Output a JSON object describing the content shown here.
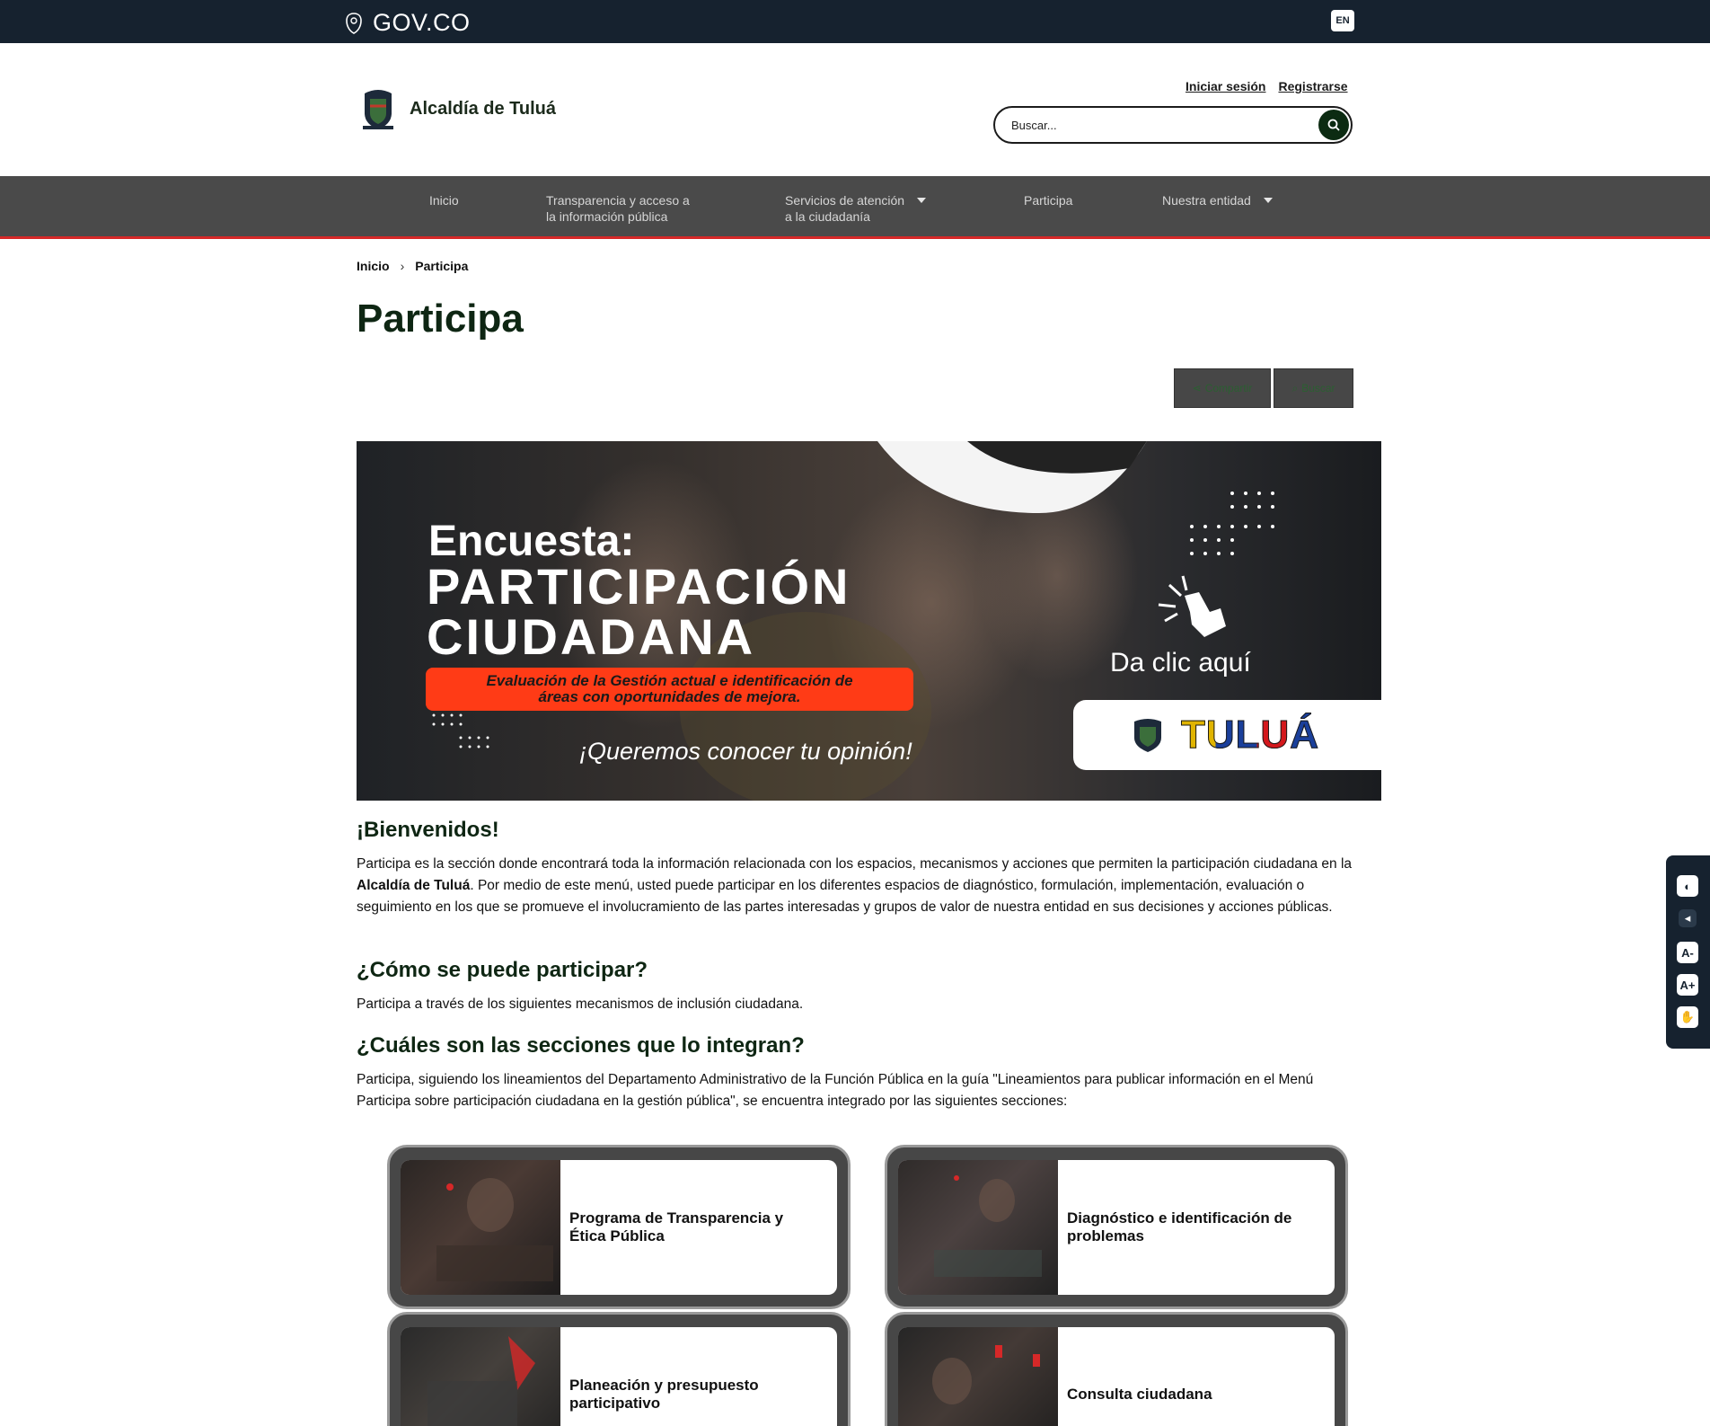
{
  "govbar": {
    "logo_text": "GOV.CO",
    "lang_button": "EN"
  },
  "header": {
    "brand_name": "Alcaldía de Tuluá",
    "login": "Iniciar sesión",
    "register": "Registrarse",
    "search_placeholder": "Buscar..."
  },
  "nav": {
    "items": [
      {
        "line1": "Inicio",
        "line2": ""
      },
      {
        "line1": "Transparencia y acceso a",
        "line2": "la información pública"
      },
      {
        "line1": "Servicios de atención",
        "line2": "a la ciudadanía"
      },
      {
        "line1": "Participa",
        "line2": ""
      },
      {
        "line1": "Nuestra entidad",
        "line2": ""
      }
    ]
  },
  "breadcrumb": {
    "home": "Inicio",
    "current": "Participa"
  },
  "page": {
    "title": "Participa",
    "share_label": "Compartir",
    "search_label": "Buscar"
  },
  "banner": {
    "line1": "Encuesta:",
    "line2": "PARTICIPACIÓN",
    "line3": "CIUDADANA",
    "pill_line1": "Evaluación de la Gestión actual e identificación de",
    "pill_line2": "áreas con oportunidades de mejora.",
    "opinion": "¡Queremos conocer tu opinión!",
    "click": "Da clic aquí",
    "logo_text": "TULUÁ"
  },
  "content": {
    "welcome_title": "¡Bienvenidos!",
    "welcome_p1": "Participa es la sección donde encontrará toda la información relacionada con los espacios, mecanismos y acciones que permiten la participación ciudadana en la ",
    "welcome_bold": "Alcaldía de Tuluá",
    "welcome_p2": ". Por medio de este menú, usted puede participar en los diferentes espacios de diagnóstico, formulación, implementación, evaluación o seguimiento en los que se promueve el involucramiento de las partes interesadas y grupos de valor de nuestra entidad en sus decisiones y acciones públicas.",
    "how_title": "¿Cómo se puede participar?",
    "how_text": "Participa a través de los siguientes mecanismos de inclusión ciudadana.",
    "sections_title": "¿Cuáles son las secciones que lo integran?",
    "sections_text": "Participa, siguiendo los lineamientos del Departamento Administrativo de la Función Pública en la guía \"Lineamientos para publicar información en el Menú Participa sobre participación ciudadana en la gestión pública\", se encuentra integrado por las siguientes secciones:"
  },
  "cards": [
    {
      "label": "Programa de Transparencia y Ética Pública"
    },
    {
      "label": "Diagnóstico e identificación de problemas"
    },
    {
      "label": "Planeación y presupuesto participativo"
    },
    {
      "label": "Consulta ciudadana"
    }
  ],
  "colors": {
    "govbar": "#16222f",
    "nav": "#4a4a4a",
    "nav_border": "#d62828",
    "title": "#0e2613",
    "banner_pill": "#ff3b16"
  }
}
